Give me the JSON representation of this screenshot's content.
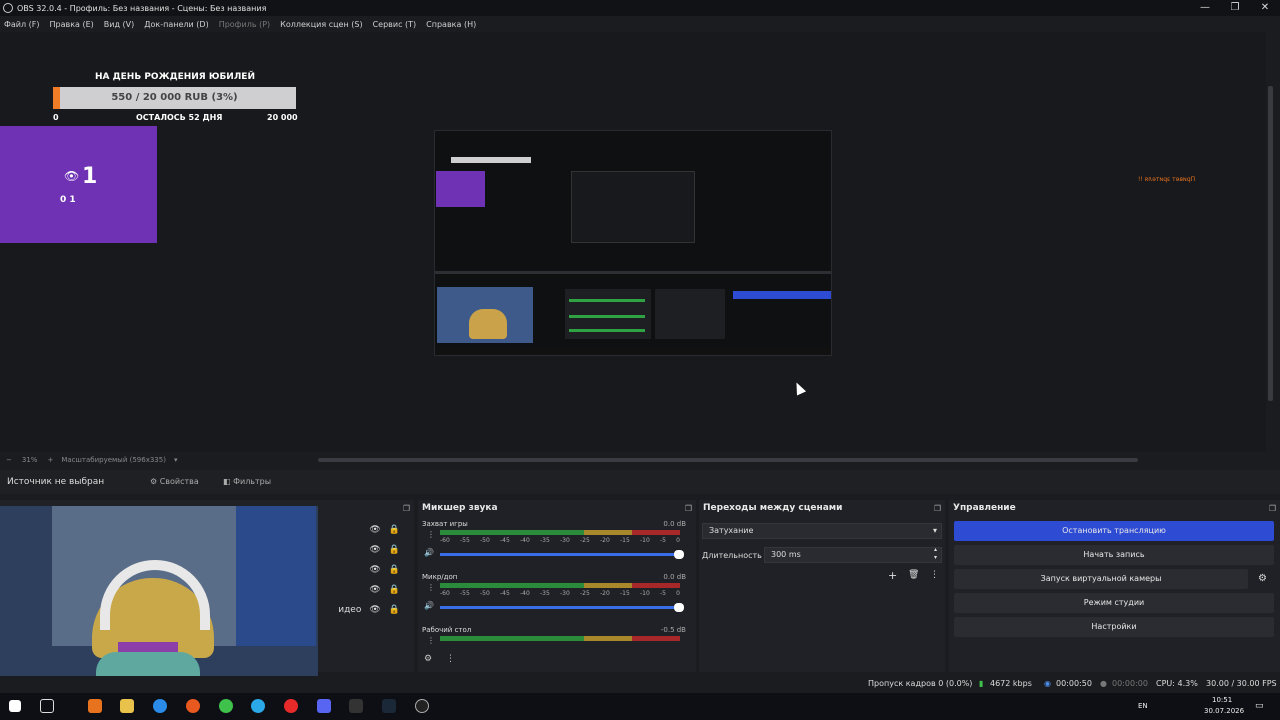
{
  "window": {
    "title": "OBS 32.0.4 - Профиль: Без названия - Сцены: Без названия",
    "minimize_glyph": "—",
    "maximize_glyph": "❐",
    "close_glyph": "✕"
  },
  "menu": [
    "Файл (F)",
    "Правка (E)",
    "Вид (V)",
    "Док-панели (D)",
    "Профиль (P)",
    "Коллекция сцен (S)",
    "Сервис (T)",
    "Справка (H)"
  ],
  "overlay": {
    "goal_title": "НА ДЕНЬ РОЖДЕНИЯ ЮБИЛЕЙ",
    "goal_progress_text": "550 / 20 000 RUB (3%)",
    "goal_progress_fraction": 0.03,
    "goal_min": "0",
    "goal_remaining": "ОСТАЛОСЬ 52 ДНЯ",
    "goal_max": "20 000",
    "viewer_count": "1",
    "viewer_sub": "0  1",
    "nested_text": "Привет зрителя !!"
  },
  "preview_bar": {
    "zoom": "31%",
    "scale_mode": "Масштабируемый (596x335)",
    "minus": "−",
    "plus": "+"
  },
  "source_bar": {
    "no_source": "Источник не выбран",
    "properties": "Свойства",
    "filters": "Фильтры"
  },
  "scenes_dock": {
    "partial_label": "идео"
  },
  "mixer": {
    "title": "Микшер звука",
    "ticks": [
      "-60",
      "-55",
      "-50",
      "-45",
      "-40",
      "-35",
      "-30",
      "-25",
      "-20",
      "-15",
      "-10",
      "-5",
      "0"
    ],
    "tracks": [
      {
        "name": "Захват игры",
        "db": "0.0 dB"
      },
      {
        "name": "Микр/доп",
        "db": "0.0 dB"
      },
      {
        "name": "Рабочий стол",
        "db": "-0.5 dB"
      }
    ]
  },
  "transitions": {
    "title": "Переходы между сценами",
    "selected": "Затухание",
    "duration_label": "Длительность",
    "duration_value": "300 ms"
  },
  "controls": {
    "title": "Управление",
    "buttons": [
      "Остановить трансляцию",
      "Начать запись",
      "Запуск виртуальной камеры",
      "Режим студии",
      "Настройки"
    ]
  },
  "status": {
    "dropped": "Пропуск кадров 0 (0.0%)",
    "bitrate": "4672 kbps",
    "stream_time": "00:00:50",
    "rec_time": "00:00:00",
    "cpu": "CPU: 4.3%",
    "fps": "30.00 / 30.00 FPS"
  },
  "taskbar": {
    "lang": "EN",
    "time": "10:51",
    "date": "30.07.2026"
  },
  "colors": {
    "accent_blue": "#2e4bd3",
    "overlay_purple": "#7032b5",
    "goal_orange": "#f07c28"
  }
}
